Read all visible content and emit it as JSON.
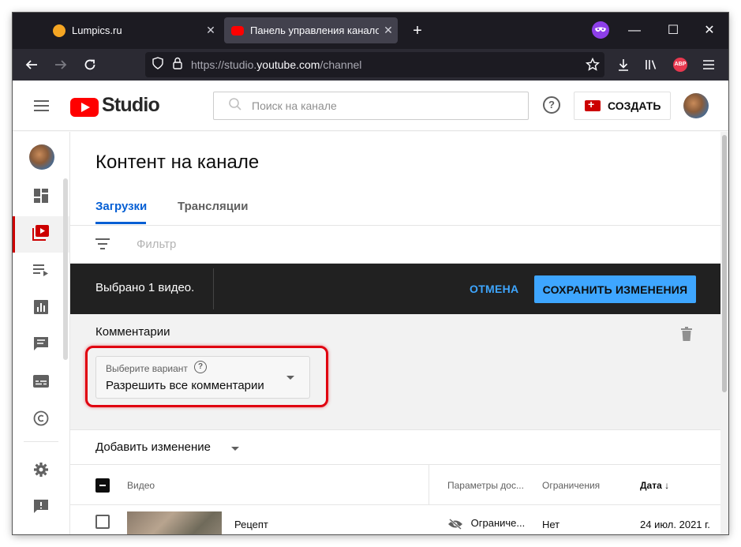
{
  "browser": {
    "tabs": [
      {
        "title": "Lumpics.ru",
        "favicon_color": "#f5a623",
        "active": false
      },
      {
        "title": "Панель управления каналом",
        "favicon_color": "#ff0000",
        "active": true
      }
    ],
    "new_tab_label": "+",
    "url_prefix": "https://studio.",
    "url_domain": "youtube.com",
    "url_path": "/channel",
    "extension_badge": "ABP"
  },
  "header": {
    "logo_text": "Studio",
    "search_placeholder": "Поиск на канале",
    "help_label": "?",
    "create_label": "СОЗДАТЬ"
  },
  "sidebar": {
    "items": [
      {
        "icon": "dashboard-icon"
      },
      {
        "icon": "content-icon",
        "active": true
      },
      {
        "icon": "playlists-icon"
      },
      {
        "icon": "analytics-icon"
      },
      {
        "icon": "comments-icon"
      },
      {
        "icon": "subtitles-icon"
      },
      {
        "icon": "copyright-icon"
      },
      {
        "icon": "settings-icon"
      },
      {
        "icon": "feedback-icon"
      }
    ]
  },
  "main": {
    "title": "Контент на канале",
    "tabs": [
      {
        "label": "Загрузки",
        "active": true
      },
      {
        "label": "Трансляции",
        "active": false
      }
    ],
    "filter_placeholder": "Фильтр"
  },
  "action_bar": {
    "selected_text": "Выбрано 1 видео.",
    "cancel_label": "ОТМЕНА",
    "save_label": "СОХРАНИТЬ ИЗМЕНЕНИЯ"
  },
  "edit_panel": {
    "section_label": "Комментарии",
    "select_label": "Выберите вариант",
    "select_value": "Разрешить все комментарии"
  },
  "add_change_label": "Добавить изменение",
  "table": {
    "headers": {
      "video": "Видео",
      "visibility": "Параметры дос...",
      "restrictions": "Ограничения",
      "date": "Дата"
    },
    "rows": [
      {
        "title": "Рецепт",
        "visibility": "Ограниче...",
        "restrictions": "Нет",
        "date": "24 июл. 2021 г."
      }
    ]
  },
  "colors": {
    "accent_blue": "#065fd4",
    "save_button": "#3ea6ff",
    "youtube_red": "#ff0000",
    "highlight_red": "#e0000f"
  }
}
